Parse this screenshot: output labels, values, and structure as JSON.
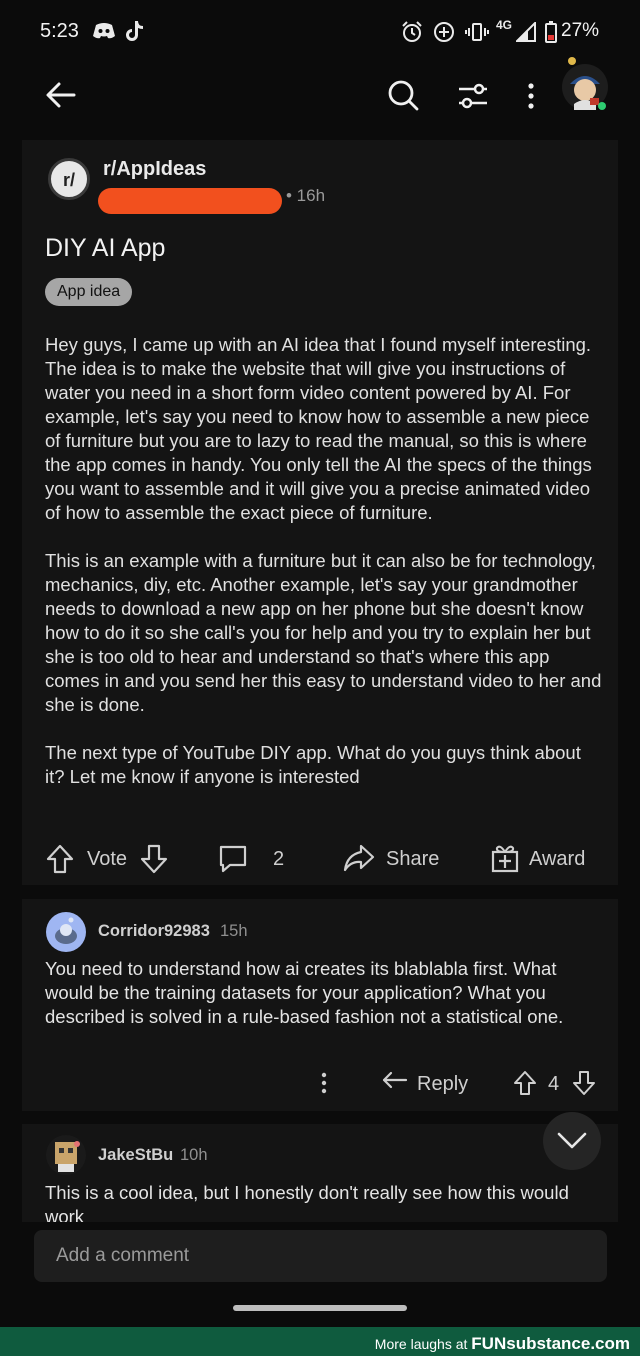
{
  "status_bar": {
    "time": "5:23",
    "network": "4G",
    "battery": "27%"
  },
  "app_bar": {
    "icons": [
      "back-arrow-icon",
      "search-icon",
      "sort-filter-icon",
      "more-vertical-icon",
      "user-avatar"
    ]
  },
  "post": {
    "subreddit": "r/AppIdeas",
    "subreddit_icon_text": "r/",
    "time": "• 16h",
    "title": "DIY AI App",
    "flair": "App idea",
    "paragraphs": [
      "Hey guys, I came up with an AI idea that I found myself interesting. The idea is to make the website that will give you instructions of water you need in a short form video content powered by AI. For example, let's say you need to know how to assemble a new piece of furniture but you are to lazy to read the manual, so this is where the app comes in handy. You only tell the AI the specs of the things you want to assemble and it will give you a precise animated video of how to assemble the exact piece of furniture.",
      "This is an example with a furniture but it can also be for technology, mechanics, diy, etc. Another example, let's say your grandmother needs to download a new app on her phone but she doesn't know how to do it so she call's you for help and you try to explain her but she is too old to hear and understand so that's where this app comes in and you send her this easy to understand video to her and she is done.",
      "The next type of YouTube DIY app. What do you guys think about it? Let me know if anyone is interested"
    ],
    "actions": {
      "vote_label": "Vote",
      "comment_count": "2",
      "share_label": "Share",
      "award_label": "Award"
    }
  },
  "comments": [
    {
      "user": "Corridor92983",
      "time": "15h",
      "text": "You need to understand how ai creates its  blablabla first. What would be the training datasets for your application? What you described is solved in a rule-based fashion not a statistical one.",
      "reply_label": "Reply",
      "score": "4"
    },
    {
      "user": "JakeStBu",
      "time": "10h",
      "text": "This is a cool idea, but I honestly don't really see how this would work"
    }
  ],
  "add_comment": {
    "placeholder": "Add a comment"
  },
  "watermark": {
    "text": "More laughs at",
    "brand": "FUNsubstance.com"
  },
  "colors": {
    "background": "#0b0b0b",
    "card": "#141414",
    "redaction": "#f2501e",
    "footer": "#0f5b3e"
  }
}
